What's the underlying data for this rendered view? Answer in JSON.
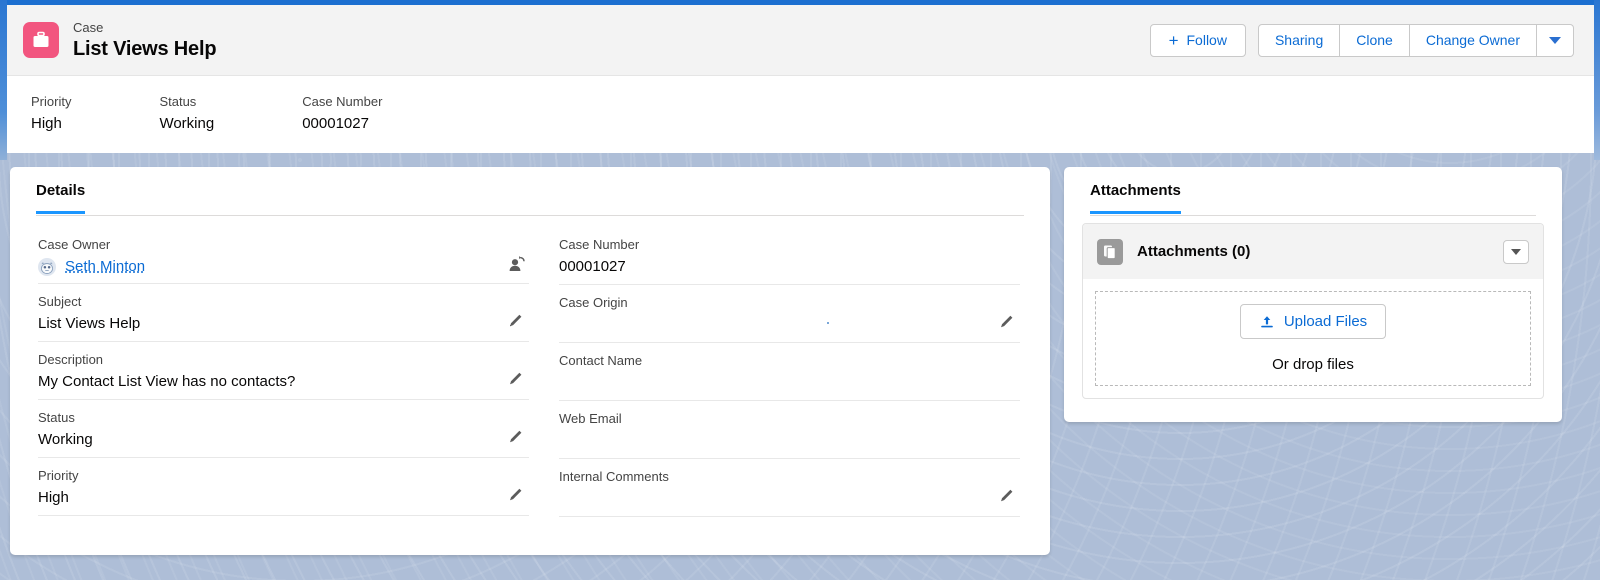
{
  "header": {
    "icon_name": "case-briefcase-icon",
    "eyebrow": "Case",
    "title": "List Views Help",
    "accent_color": "#f2557f",
    "actions": {
      "follow": "Follow",
      "sharing": "Sharing",
      "clone": "Clone",
      "change_owner": "Change Owner",
      "more_label": "More actions"
    }
  },
  "highlights": [
    {
      "label": "Priority",
      "value": "High"
    },
    {
      "label": "Status",
      "value": "Working"
    },
    {
      "label": "Case Number",
      "value": "00001027"
    }
  ],
  "details": {
    "tab_label": "Details",
    "left_fields": [
      {
        "label": "Case Owner",
        "value": "Seth Minton",
        "icon": "change-owner-icon",
        "type": "owner-link"
      },
      {
        "label": "Subject",
        "value": "List Views Help",
        "icon": "pencil-icon",
        "type": "text"
      },
      {
        "label": "Description",
        "value": "My Contact List View has no contacts?",
        "icon": "pencil-icon",
        "type": "text"
      },
      {
        "label": "Status",
        "value": "Working",
        "icon": "pencil-icon",
        "type": "text"
      },
      {
        "label": "Priority",
        "value": "High",
        "icon": "pencil-icon",
        "type": "text"
      }
    ],
    "right_fields": [
      {
        "label": "Case Number",
        "value": "00001027",
        "icon": "",
        "type": "text"
      },
      {
        "label": "Case Origin",
        "value": "",
        "icon": "pencil-icon",
        "type": "text"
      },
      {
        "label": "Contact Name",
        "value": "",
        "icon": "",
        "type": "text"
      },
      {
        "label": "Web Email",
        "value": "",
        "icon": "",
        "type": "text"
      },
      {
        "label": "Internal Comments",
        "value": "",
        "icon": "pencil-icon",
        "type": "text"
      }
    ]
  },
  "attachments": {
    "tab_label": "Attachments",
    "panel_title": "Attachments (0)",
    "panel_icon": "file-document-icon",
    "menu_icon": "chevron-down-icon",
    "upload_button": "Upload Files",
    "upload_icon": "upload-arrow-icon",
    "drop_text": "Or drop files"
  },
  "colors": {
    "background": "#aebed7",
    "link_blue": "#0b6bd4",
    "tab_underline": "#1b96ff",
    "case_pink": "#f2557f"
  }
}
